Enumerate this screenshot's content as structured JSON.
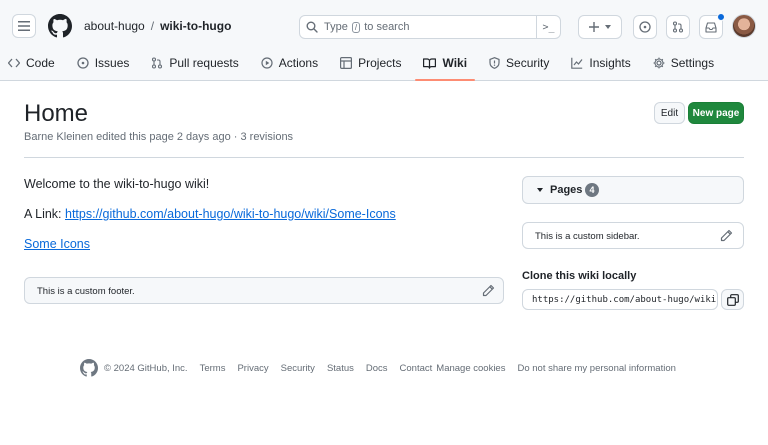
{
  "header": {
    "owner": "about-hugo",
    "separator": "/",
    "repo": "wiki-to-hugo",
    "search": {
      "prefix": "Type",
      "key": "/",
      "suffix": "to search",
      "command_icon": ">_"
    },
    "icons": [
      "menu-icon",
      "github-logo-icon",
      "search-icon",
      "command-palette-icon",
      "plus-icon",
      "issue-circle-icon",
      "pull-request-icon",
      "inbox-icon"
    ]
  },
  "tabs": [
    {
      "label": "Code",
      "icon": "code-icon"
    },
    {
      "label": "Issues",
      "icon": "issue-icon"
    },
    {
      "label": "Pull requests",
      "icon": "pull-request-icon"
    },
    {
      "label": "Actions",
      "icon": "play-icon"
    },
    {
      "label": "Projects",
      "icon": "table-icon"
    },
    {
      "label": "Wiki",
      "icon": "book-icon",
      "active": true
    },
    {
      "label": "Security",
      "icon": "shield-icon"
    },
    {
      "label": "Insights",
      "icon": "graph-icon"
    },
    {
      "label": "Settings",
      "icon": "gear-icon"
    }
  ],
  "page": {
    "title": "Home",
    "meta": "Barne Kleinen edited this page 2 days ago · 3 revisions",
    "edit_label": "Edit",
    "new_page_label": "New page"
  },
  "content": {
    "welcome": "Welcome to the wiki-to-hugo wiki!",
    "link_prefix": "A Link: ",
    "link_text": "https://github.com/about-hugo/wiki-to-hugo/wiki/Some-Icons",
    "some_icons": "Some Icons",
    "custom_footer": "This is a custom footer."
  },
  "sidebar": {
    "pages_label": "Pages",
    "pages_count": "4",
    "custom_sidebar": "This is a custom sidebar.",
    "clone_title": "Clone this wiki locally",
    "clone_url": "https://github.com/about-hugo/wiki-to-hugo.wiki.git"
  },
  "footer": {
    "copyright": "© 2024 GitHub, Inc.",
    "links": [
      "Terms",
      "Privacy",
      "Security",
      "Status",
      "Docs",
      "Contact",
      "Manage cookies",
      "Do not share my personal information"
    ]
  },
  "colors": {
    "accent_blue": "#0969da",
    "primary_green": "#1f883d",
    "active_tab_underline": "#fd8c73",
    "header_bg": "#f6f8fa"
  }
}
